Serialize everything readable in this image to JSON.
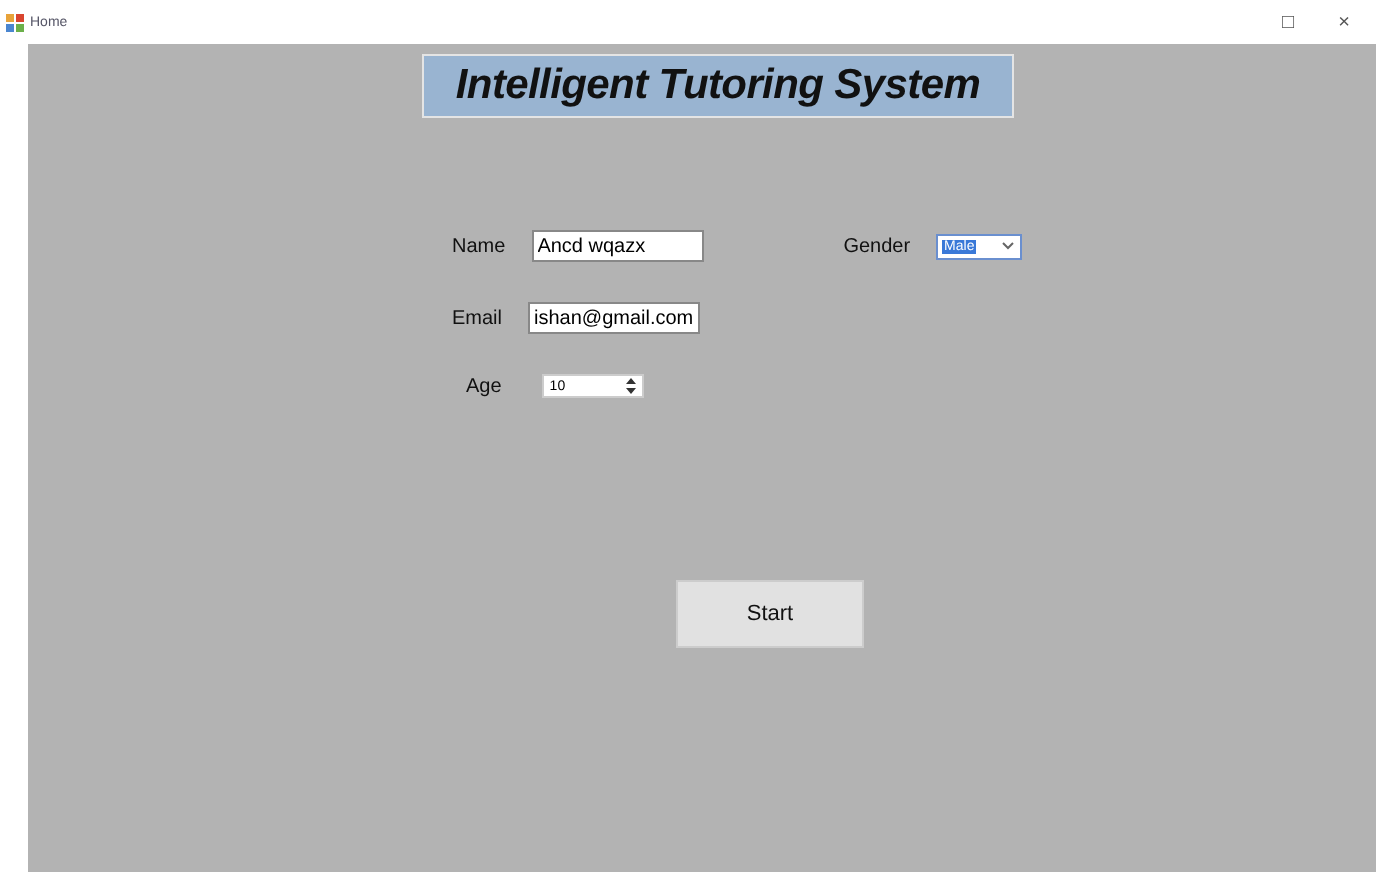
{
  "window": {
    "title": "Home",
    "controls": [
      "□",
      "×"
    ]
  },
  "banner": "Intelligent Tutoring System",
  "fields": [
    {
      "label": "Name",
      "value": "Ancd wqazx"
    },
    {
      "label": "Email",
      "value": "ishan@gmail.com"
    }
  ],
  "age": {
    "label": "Age",
    "value": "10"
  },
  "gender": {
    "label": "Gender",
    "value": "Male"
  },
  "start_button": "Start"
}
